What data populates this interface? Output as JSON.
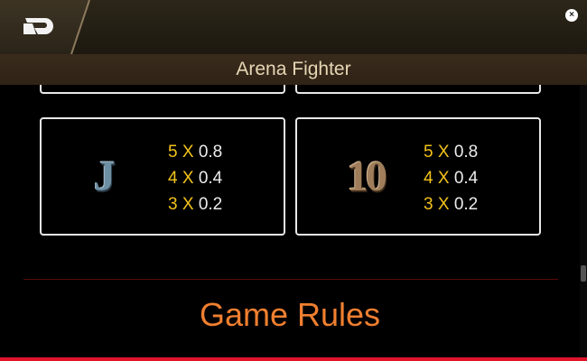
{
  "header": {
    "title": "Arena Fighter",
    "close_glyph": "×"
  },
  "icons": {
    "back": "back-logo-icon",
    "close": "close-icon"
  },
  "paytable": [
    {
      "symbol": "J",
      "rows": [
        {
          "count": "5",
          "x": "X",
          "value": "0.8"
        },
        {
          "count": "4",
          "x": "X",
          "value": "0.4"
        },
        {
          "count": "3",
          "x": "X",
          "value": "0.2"
        }
      ]
    },
    {
      "symbol": "10",
      "rows": [
        {
          "count": "5",
          "x": "X",
          "value": "0.8"
        },
        {
          "count": "4",
          "x": "X",
          "value": "0.4"
        },
        {
          "count": "3",
          "x": "X",
          "value": "0.2"
        }
      ]
    }
  ],
  "section": {
    "title": "Game Rules"
  },
  "colors": {
    "multiplier": "#f2c21b",
    "section_title": "#f07f30",
    "accent_bar": "#e0152c",
    "title_text": "#e6d6b4"
  }
}
